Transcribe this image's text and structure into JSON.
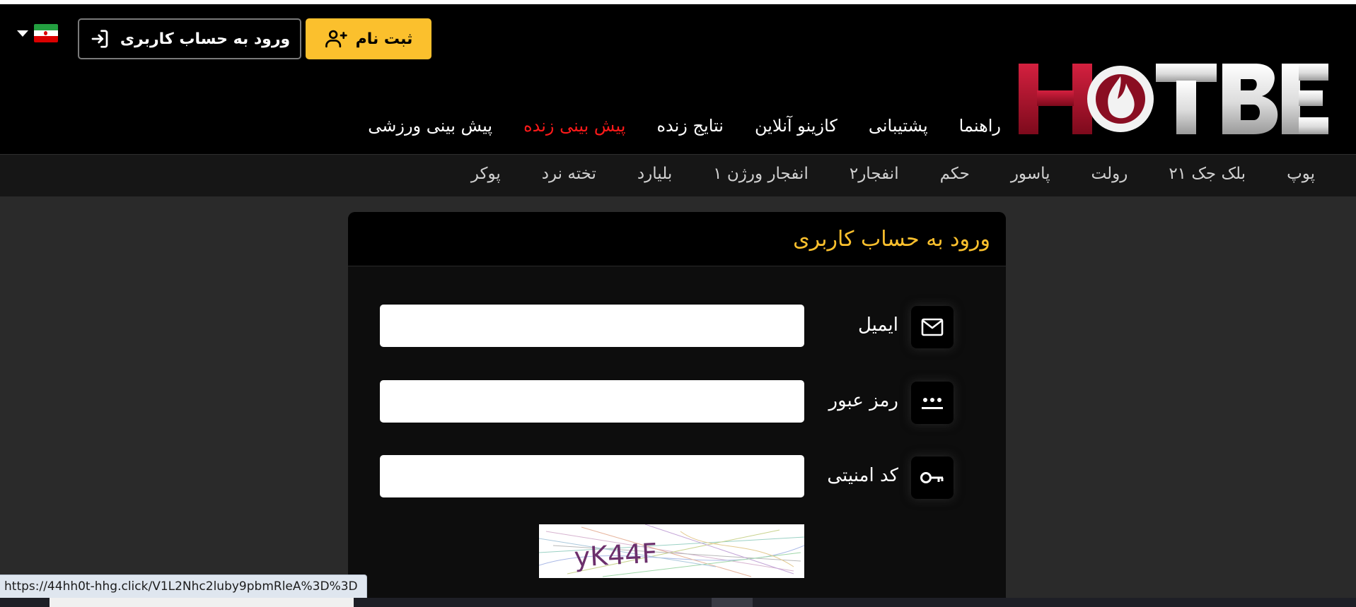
{
  "header": {
    "brand": "HOTBET",
    "signup_label": "ثبت نام",
    "login_label": "ورود به حساب کاربری",
    "language": "fa"
  },
  "main_nav": [
    {
      "label": "پیش بینی ورزشی",
      "active": false
    },
    {
      "label": "پیش بینی زنده",
      "active": true
    },
    {
      "label": "نتایج زنده",
      "active": false
    },
    {
      "label": "کازینو آنلاین",
      "active": false
    },
    {
      "label": "پشتیبانی",
      "active": false
    },
    {
      "label": "راهنما",
      "active": false
    }
  ],
  "sub_nav": [
    "پوکر",
    "تخته نرد",
    "بلیارد",
    "انفجار ورژن ۱",
    "انفجار۲",
    "حکم",
    "پاسور",
    "رولت",
    "بلک جک ۲۱",
    "پوپ"
  ],
  "login_form": {
    "title": "ورود به حساب کاربری",
    "email_label": "ایمیل",
    "email_value": "",
    "password_label": "رمز عبور",
    "password_value": "",
    "captcha_label": "کد امنیتی",
    "captcha_value": "",
    "captcha_text": "yK44F"
  },
  "status_url": "https://44hh0t-hhg.click/V1L2Nhc2luby9pbmRleA%3D%3D",
  "colors": {
    "accent": "#fbc02d",
    "active_nav": "#ff1a1a",
    "logo_red": "#b0102a"
  },
  "icons": [
    "user-plus-icon",
    "login-arrow-icon",
    "mail-icon",
    "password-dots-icon",
    "key-icon",
    "chevron-down-icon"
  ]
}
